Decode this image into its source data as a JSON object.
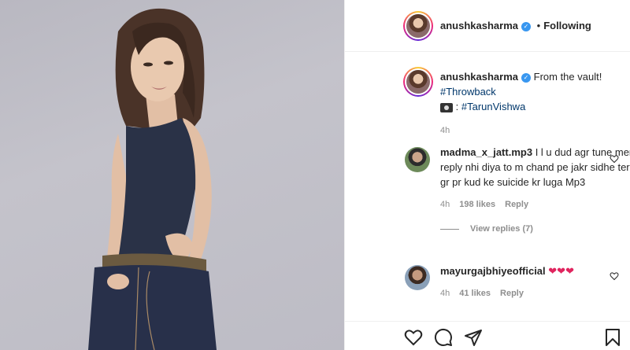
{
  "header": {
    "username": "anushkasharma",
    "separator": "•",
    "follow_status": "Following"
  },
  "caption": {
    "username": "anushkasharma",
    "text": "From the vault!",
    "hashtag": "#Throwback",
    "camera_prefix": ":",
    "credit": "#TarunVishwa",
    "time": "4h"
  },
  "comments": [
    {
      "username": "madma_x_jatt.mp3",
      "text": "I l u dud agr tune mera reply nhi diya to m chand pe jakr sidhe tere gr pr kud ke suicide kr luga Mp3",
      "time": "4h",
      "likes": "198 likes",
      "reply": "Reply",
      "view_replies": "View replies (7)"
    },
    {
      "username": "mayurgajbhiyeofficial",
      "text": "❤❤❤",
      "time": "4h",
      "likes": "41 likes",
      "reply": "Reply"
    }
  ],
  "colors": {
    "verified": "#3897f0",
    "hashtag": "#00376b",
    "heart_emoji": "#e0245e"
  },
  "icons": [
    "verified-badge-icon",
    "camera-emoji-icon",
    "heart-icon",
    "comment-icon",
    "share-icon",
    "bookmark-icon"
  ]
}
